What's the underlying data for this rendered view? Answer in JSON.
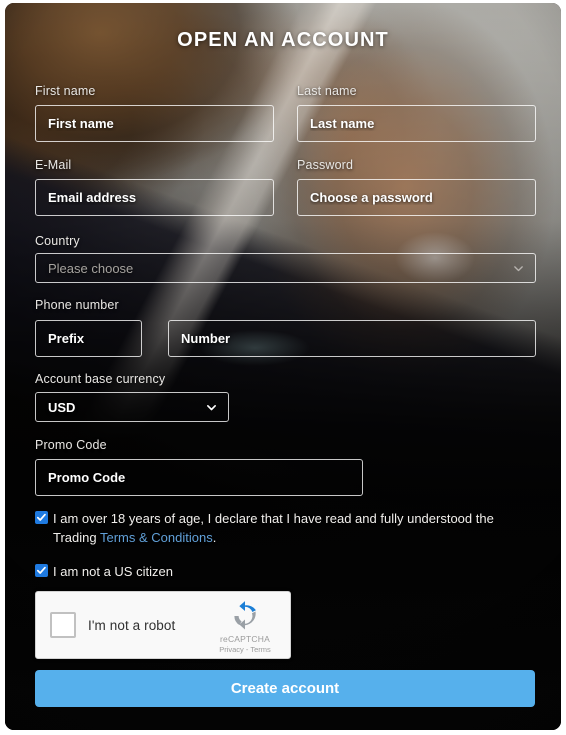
{
  "page": {
    "title": "OPEN AN ACCOUNT",
    "accent_color": "#56b0ec",
    "link_color": "#61a0d8",
    "checkbox_color": "#1f7ae0"
  },
  "form": {
    "first_name": {
      "label": "First name",
      "placeholder": "First name",
      "value": ""
    },
    "last_name": {
      "label": "Last name",
      "placeholder": "Last name",
      "value": ""
    },
    "email": {
      "label": "E-Mail",
      "placeholder": "Email address",
      "value": ""
    },
    "password": {
      "label": "Password",
      "placeholder": "Choose a password",
      "value": ""
    },
    "country": {
      "label": "Country",
      "selected": "Please choose",
      "icon": "chevron-down-icon"
    },
    "phone": {
      "label": "Phone number",
      "prefix_placeholder": "Prefix",
      "prefix_value": "",
      "number_placeholder": "Number",
      "number_value": ""
    },
    "currency": {
      "label": "Account base currency",
      "selected": "USD",
      "icon": "chevron-down-icon"
    },
    "promo": {
      "label": "Promo Code",
      "placeholder": "Promo Code",
      "value": ""
    }
  },
  "consents": {
    "age_terms": {
      "checked": true,
      "text_before": "I am over 18 years of age, I declare that I have read and fully understood the Trading ",
      "link_text": "Terms & Conditions",
      "text_after": "."
    },
    "us_citizen": {
      "checked": true,
      "text": "I am not a US citizen"
    }
  },
  "recaptcha": {
    "label": "I'm not a robot",
    "brand": "reCAPTCHA",
    "links": "Privacy - Terms",
    "checked": false
  },
  "actions": {
    "submit_label": "Create account"
  }
}
